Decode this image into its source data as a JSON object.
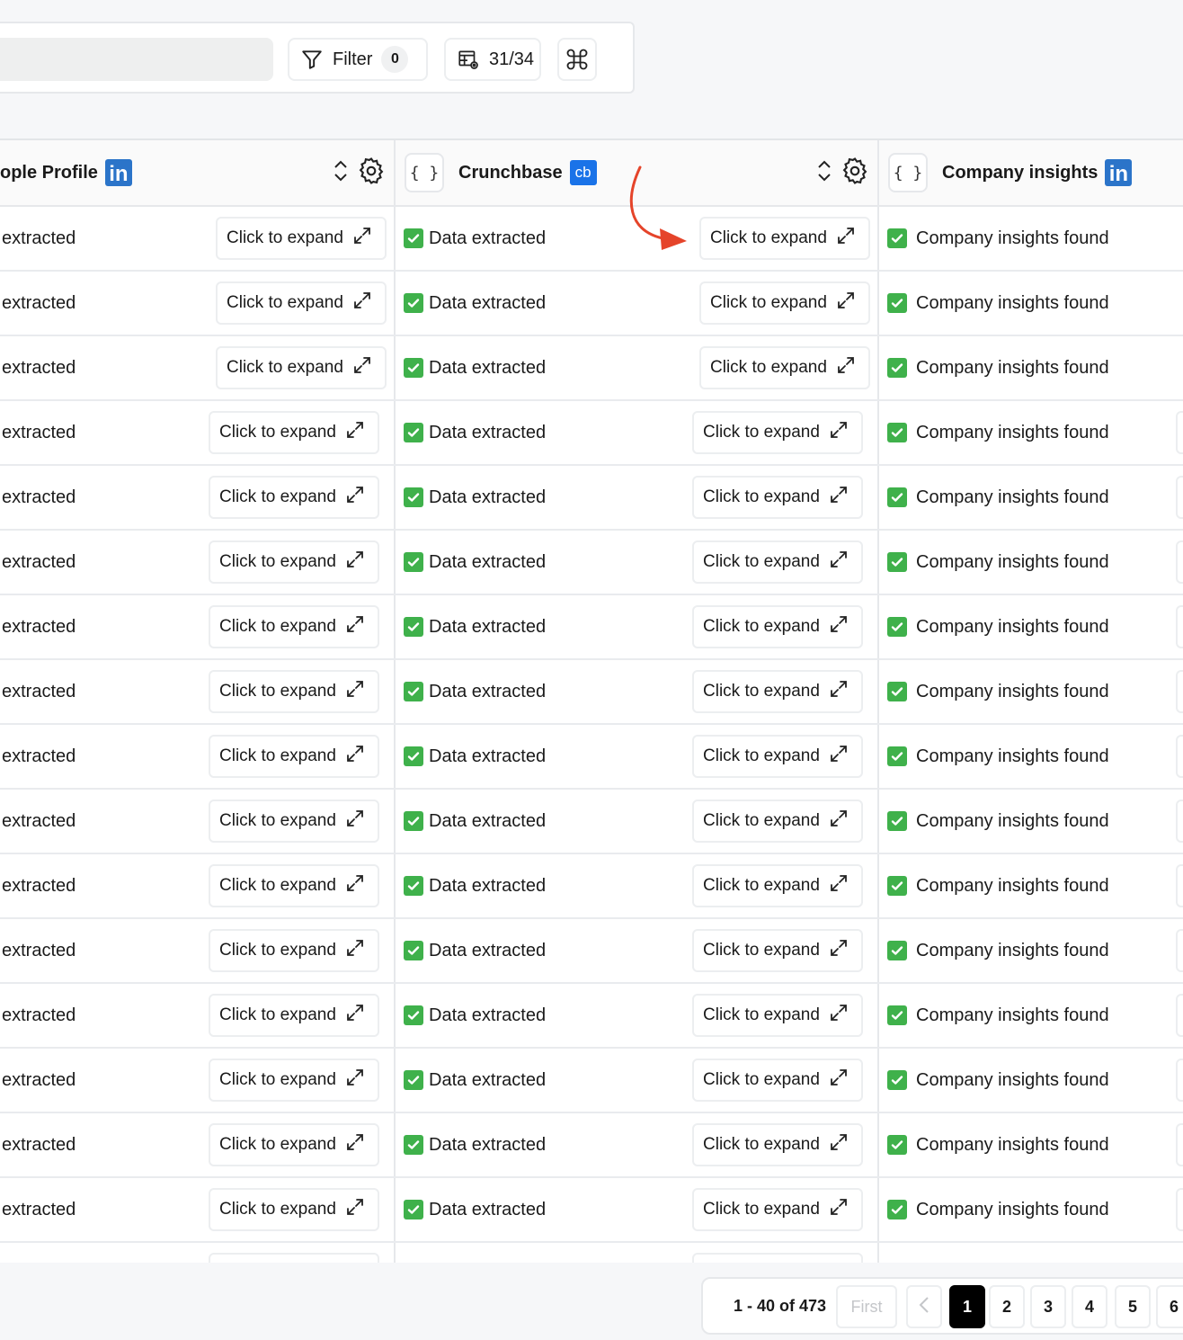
{
  "toolbar": {
    "filter_label": "Filter",
    "filter_count": "0",
    "columns_label": "31/34"
  },
  "columns": [
    {
      "title": "ople Profile",
      "badge": "in"
    },
    {
      "title": "Crunchbase",
      "badge": "cb",
      "brace": "{ }"
    },
    {
      "title": "Company insights",
      "badge": "in",
      "brace": "{ }"
    }
  ],
  "cells": {
    "col1_status": "extracted",
    "col2_status": "Data extracted",
    "col3_status": "Company insights found",
    "expand_label": "Click to expand"
  },
  "row_count": 16,
  "pagination": {
    "range": "1 - 40 of 473",
    "first_label": "First",
    "pages": [
      "1",
      "2",
      "3",
      "4",
      "5",
      "6"
    ],
    "current_page": "1"
  },
  "colors": {
    "accent_annotation": "#e5442a",
    "check_green": "#3fb14b",
    "linkedin_blue": "#2b74c9",
    "crunchbase_blue": "#1a73e8"
  }
}
